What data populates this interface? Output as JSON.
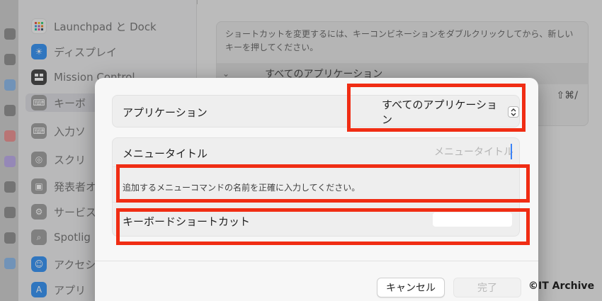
{
  "background": {
    "sidebar_items": [
      {
        "label": "Launchpad と Dock",
        "icon": "launchpad-icon",
        "color": "#e9e9e9"
      },
      {
        "label": "ディスプレイ",
        "icon": "display-icon",
        "color": "#2b8cf2"
      },
      {
        "label": "Mission Control",
        "icon": "mission-control-icon",
        "color": "#3b3b3b"
      },
      {
        "label": "キーボ",
        "icon": "keyboard-icon",
        "color": "#9a9a9a"
      },
      {
        "label": "入力ソ",
        "icon": "input-source-icon",
        "color": "#9a9a9a"
      },
      {
        "label": "スクリ",
        "icon": "screenshot-icon",
        "color": "#9a9a9a"
      },
      {
        "label": "発表者オ",
        "icon": "presenter-icon",
        "color": "#9a9a9a"
      },
      {
        "label": "サービス",
        "icon": "services-icon",
        "color": "#9a9a9a"
      },
      {
        "label": "Spotlig",
        "icon": "spotlight-icon",
        "color": "#9a9a9a"
      },
      {
        "label": "アクセシ",
        "icon": "accessibility-icon",
        "color": "#2b8cf2"
      },
      {
        "label": "アプリ",
        "icon": "app-store-icon",
        "color": "#2b8cf2"
      }
    ],
    "instructions": "ショートカットを変更するには、キーコンビネーションをダブルクリックしてから、新しいキーを押してください。",
    "all_apps_row": "すべてのアプリケーション",
    "existing_shortcut": "⇧⌘/"
  },
  "dialog": {
    "application_label": "アプリケーション",
    "application_value": "すべてのアプリケーション",
    "menu_title_label": "メニュータイトル",
    "menu_title_placeholder": "メニュータイトル",
    "hint": "追加するメニューコマンドの名前を正確に入力してください。",
    "keyboard_shortcut_label": "キーボードショートカット",
    "cancel": "キャンセル",
    "done": "完了"
  },
  "annotations": {
    "highlight_color": "#f02d14",
    "watermark": "©IT Archive"
  }
}
